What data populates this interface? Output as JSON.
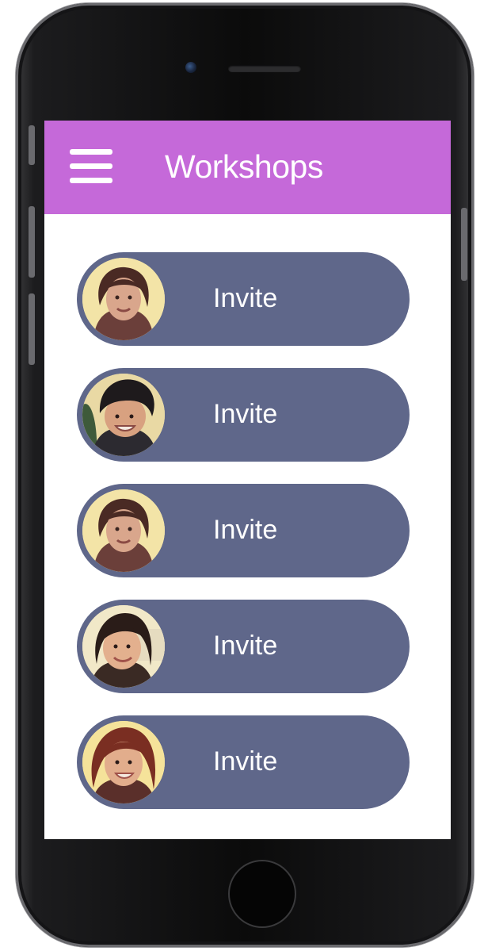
{
  "header": {
    "title": "Workshops",
    "menu_icon": "hamburger-menu-icon",
    "background_color": "#c569d9"
  },
  "invites": [
    {
      "label": "Invite",
      "avatar_icon": "person-photo-avatar"
    },
    {
      "label": "Invite",
      "avatar_icon": "person-photo-avatar"
    },
    {
      "label": "Invite",
      "avatar_icon": "person-photo-avatar"
    },
    {
      "label": "Invite",
      "avatar_icon": "person-photo-avatar"
    },
    {
      "label": "Invite",
      "avatar_icon": "person-photo-avatar"
    }
  ],
  "colors": {
    "invite_button": "#5f678a",
    "text": "#ffffff",
    "screen_background": "#ffffff"
  }
}
